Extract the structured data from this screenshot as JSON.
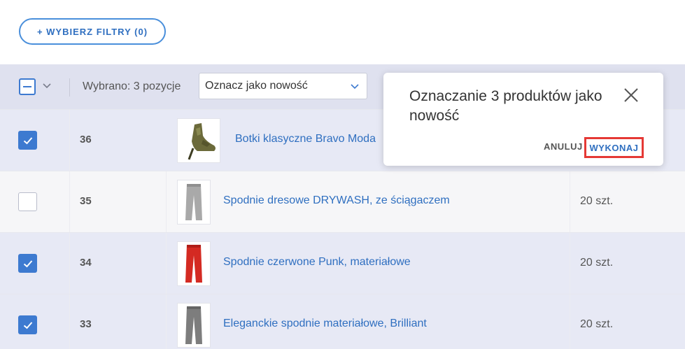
{
  "toolbar": {
    "filter_label": "+ WYBIERZ FILTRY (0)"
  },
  "bulk": {
    "selected_text": "Wybrano: 3 pozycje",
    "action_value": "Oznacz jako nowość"
  },
  "rows": [
    {
      "id": "36",
      "name": "Botki klasyczne Bravo Moda",
      "qty": "",
      "checked": true
    },
    {
      "id": "35",
      "name": "Spodnie dresowe DRYWASH, ze ściągaczem",
      "qty": "20 szt.",
      "checked": false
    },
    {
      "id": "34",
      "name": "Spodnie czerwone Punk, materiałowe",
      "qty": "20 szt.",
      "checked": true
    },
    {
      "id": "33",
      "name": "Eleganckie spodnie materiałowe, Brilliant",
      "qty": "20 szt.",
      "checked": true
    }
  ],
  "popup": {
    "title": "Oznaczanie 3 produktów jako nowość",
    "cancel_label": "ANULUJ",
    "execute_label": "WYKONAJ"
  },
  "icons": {
    "chevron": "chevron-down-icon",
    "close": "close-icon",
    "check": "check-icon"
  },
  "colors": {
    "accent": "#3d7ad0",
    "link": "#2f6fc0",
    "highlight": "#e53935",
    "bulk_bar": "#dfe1ef",
    "row_selected": "#e7e9f5"
  }
}
